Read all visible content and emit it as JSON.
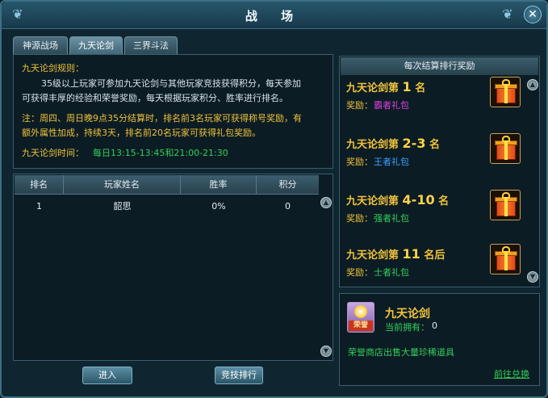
{
  "window": {
    "title": "战 场",
    "close_glyph": "✕"
  },
  "tabs": [
    {
      "label": "神源战场",
      "active": false
    },
    {
      "label": "九天论剑",
      "active": true
    },
    {
      "label": "三界斗法",
      "active": false
    }
  ],
  "rules": {
    "heading": "九天论剑规则：",
    "line1": "35级以上玩家可参加九天论剑与其他玩家竞技获得积分，每天参加",
    "line2": "可获得丰厚的经验和荣誉奖励，每天根据玩家积分、胜率进行排名。",
    "note1": "注：周四、周日晚9点35分结算时，排名前3名玩家可获得称号奖励，有",
    "note2": "额外属性加成，持续3天，排名前20名玩家可获得礼包奖励。",
    "time_label": "九天论剑时间：",
    "time_value": "每日13:15-13:45和21:00-21:30"
  },
  "rank_table": {
    "columns": [
      "排名",
      "玩家姓名",
      "胜率",
      "积分"
    ],
    "rows": [
      {
        "rank": "1",
        "name": "韶思",
        "win_rate": "0%",
        "score": "0"
      }
    ]
  },
  "buttons": {
    "enter": "进入",
    "ranking": "竞技排行"
  },
  "rewards": {
    "heading": "每次结算排行奖励",
    "items": [
      {
        "prefix": "九天论剑第",
        "rank": "1",
        "suffix": "名",
        "label": "奖励：",
        "item": "霸者礼包",
        "item_color": "#e040e0"
      },
      {
        "prefix": "九天论剑第",
        "rank": "2-3",
        "suffix": "名",
        "label": "奖励：",
        "item": "王者礼包",
        "item_color": "#3aa0ff"
      },
      {
        "prefix": "九天论剑第",
        "rank": "4-10",
        "suffix": "名",
        "label": "奖励：",
        "item": "强者礼包",
        "item_color": "#35d05a"
      },
      {
        "prefix": "九天论剑第",
        "rank": "11",
        "suffix": "名后",
        "label": "奖励：",
        "item": "士者礼包",
        "item_color": "#35d05a"
      }
    ]
  },
  "honor": {
    "title": "九天论剑",
    "icon_text": "荣誉",
    "owned_label": "当前拥有：",
    "owned_value": "0",
    "shop_text": "荣誉商店出售大量珍稀道具",
    "exchange_link": "前往兑换"
  },
  "colors": {
    "gold": "#f0c23a",
    "green": "#35d05a",
    "frame": "#3d6f86"
  },
  "icons": [
    "ornament-icon",
    "close-icon",
    "scroll-up-icon",
    "scroll-down-icon",
    "gift-box-icon",
    "honor-medal-icon"
  ]
}
